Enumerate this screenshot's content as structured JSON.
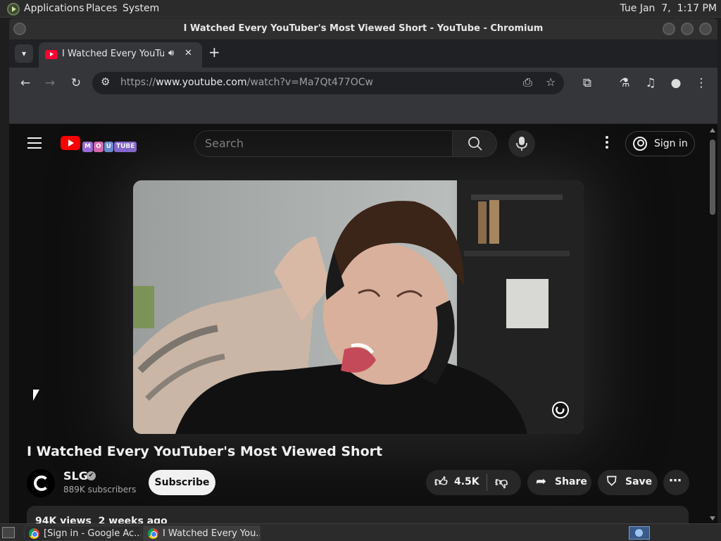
{
  "top_panel": {
    "menus": [
      "Applications",
      "Places",
      "System"
    ],
    "clock": "Tue Jan  7,  1:17 PM"
  },
  "window": {
    "title": "I Watched Every YouTuber's Most Viewed Short - YouTube - Chromium"
  },
  "tab": {
    "title": "I Watched Every YouTube",
    "audio_icon": "speaker-icon"
  },
  "toolbar": {
    "url_prefix": "https://",
    "url_host": "www.youtube.com",
    "url_path": "/watch?v=Ma7Qt477OCw"
  },
  "youtube": {
    "logo_letters": [
      "M",
      "O",
      "U",
      "TUBE"
    ],
    "search_placeholder": "Search",
    "sign_in_label": "Sign in",
    "video_title": "I Watched Every YouTuber's Most Viewed Short",
    "channel_name": "SLG",
    "verified_mark": "✔",
    "subscribers": "889K subscribers",
    "subscribe_label": "Subscribe",
    "like_count": "4.5K",
    "share_label": "Share",
    "save_label": "Save",
    "description_preview": "94K views  2 weeks ago"
  },
  "taskbar": {
    "tasks": [
      "[Sign in - Google Ac...",
      "I Watched Every You..."
    ]
  },
  "colors": {
    "page_bg": "#0f0f0f",
    "brand_red": "#ff0000",
    "chrome_dark": "#35363a"
  }
}
